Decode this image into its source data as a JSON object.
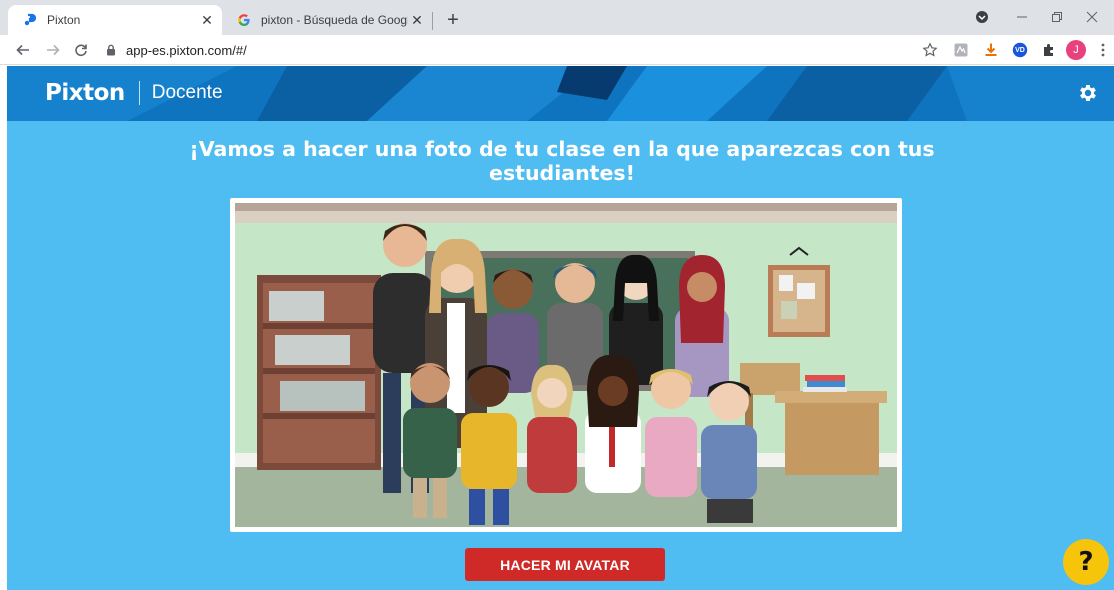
{
  "browser": {
    "tabs": [
      {
        "title": "Pixton",
        "favicon": "pixton-p-icon"
      },
      {
        "title": "pixton - Búsqueda de Google",
        "favicon": "google-g-icon"
      }
    ],
    "close_glyph": "✕",
    "newtab_glyph": "+",
    "url": "app-es.pixton.com/#/",
    "profile_initial": "J",
    "ext_initials": {
      "vd": "VD"
    }
  },
  "app": {
    "logo_text": "Pixton",
    "role_label": "Docente",
    "headline": "¡Vamos a hacer una foto de tu clase en la que aparezcas con tus estudiantes!",
    "cta_label": "HACER MI AVATAR",
    "help_label": "?",
    "colors": {
      "header": "#0f74c0",
      "background": "#4fbdf2",
      "cta": "#cf2a27",
      "help": "#f6c40a"
    }
  }
}
